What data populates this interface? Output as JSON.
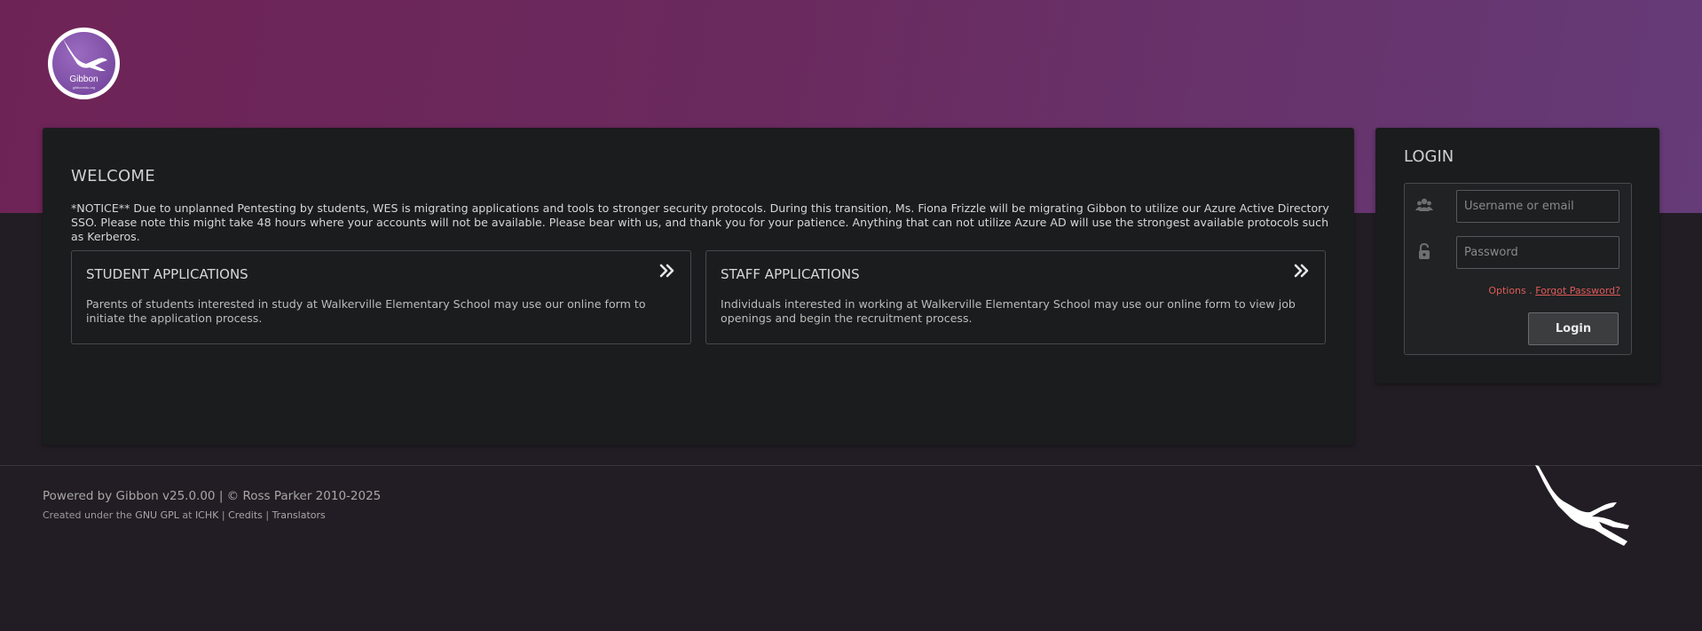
{
  "header": {
    "logo_text": "Gibbon",
    "logo_subtext": "gibbonedu.org"
  },
  "welcome": {
    "title": "WELCOME",
    "notice": "*NOTICE** Due to unplanned Pentesting by students, WES is migrating applications and tools to stronger security protocols. During this transition, Ms. Fiona Frizzle will be migrating Gibbon to utilize our Azure Active Directory SSO. Please note this might take 48 hours where your accounts will not be available. Please bear with us, and thank you for your patience. Anything that can not utilize Azure AD will use the strongest available protocols such as Kerberos.",
    "cards": [
      {
        "title": "STUDENT APPLICATIONS",
        "description": "Parents of students interested in study at Walkerville Elementary School may use our online form to initiate the application process.",
        "icon": "double-chevron-right-icon"
      },
      {
        "title": "STAFF APPLICATIONS",
        "description": "Individuals interested in working at Walkerville Elementary School may use our online form to view job openings and begin the recruitment process.",
        "icon": "double-chevron-right-icon"
      }
    ]
  },
  "login": {
    "title": "LOGIN",
    "username_placeholder": "Username or email",
    "password_placeholder": "Password",
    "options_label": "Options",
    "separator": ".",
    "forgot_label": "Forgot Password?",
    "button_label": "Login",
    "user_icon": "users-icon",
    "lock_icon": "lock-icon"
  },
  "footer": {
    "powered_prefix": "Powered by ",
    "powered_link": "Gibbon v25.0.00",
    "powered_suffix": " | © Ross Parker 2010-2025",
    "created_prefix": "Created under the ",
    "gpl_link": "GNU GPL",
    "at_text": " at ",
    "ichk_link": "ICHK",
    "sep1": " | ",
    "credits_link": "Credits",
    "sep2": " | ",
    "translators_link": "Translators"
  },
  "colors": {
    "header_gradient_start": "#6e2356",
    "header_gradient_end": "#653b78",
    "panel_bg": "#1b1c1d",
    "page_bg": "#221d24",
    "link_red": "#e05a5a"
  }
}
